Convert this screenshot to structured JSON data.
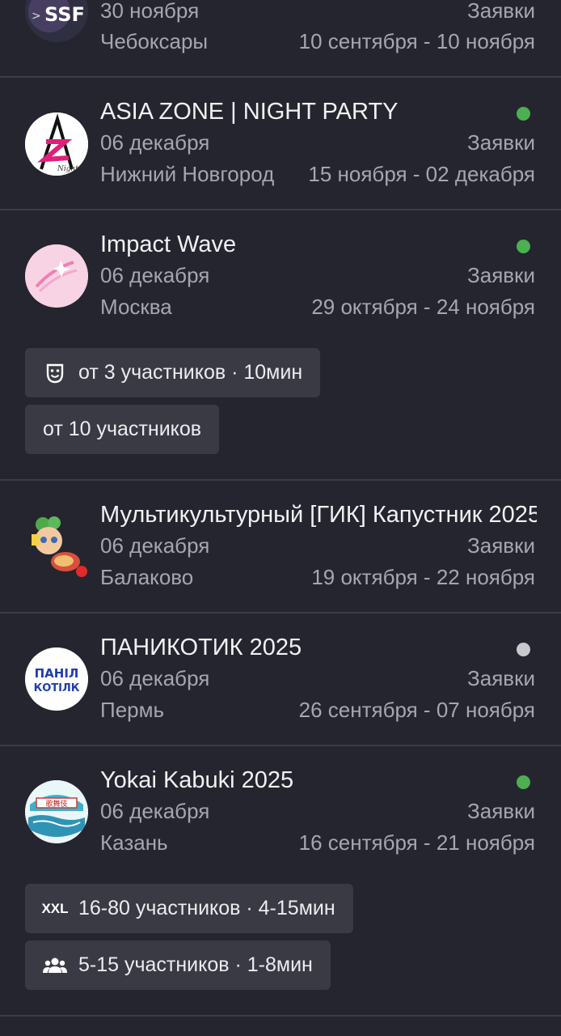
{
  "events": [
    {
      "title": "",
      "date": "30 ноября",
      "status": "Заявки",
      "city": "Чебоксары",
      "period": "10 сентября - 10 ноября",
      "avatar_text": "SSF"
    },
    {
      "title": "ASIA ZONE | NIGHT PARTY",
      "date": "06 декабря",
      "status": "Заявки",
      "city": "Нижний Новгород",
      "period": "15 ноября - 02 декабря",
      "indicator": "green"
    },
    {
      "title": "Impact Wave",
      "date": "06 декабря",
      "status": "Заявки",
      "city": "Москва",
      "period": "29 октября - 24 ноября",
      "indicator": "green",
      "chips": [
        {
          "icon": "theater-mask-icon",
          "label": "от 3 участников · 10мин"
        },
        {
          "icon": "",
          "label": "от 10 участников"
        }
      ]
    },
    {
      "title": "Мультикультурный [ГИК] Капустник 2025",
      "date": "06 декабря",
      "status": "Заявки",
      "city": "Балаково",
      "period": "19 октября - 22 ноября"
    },
    {
      "title": "ПАНИКОТИК 2025",
      "date": "06 декабря",
      "status": "Заявки",
      "city": "Пермь",
      "period": "26 сентября - 07 ноября",
      "indicator": "gray",
      "avatar_text_top": "ПАНІЛ",
      "avatar_text_bottom": "КОТІЛК"
    },
    {
      "title": "Yokai Kabuki 2025",
      "date": "06 декабря",
      "status": "Заявки",
      "city": "Казань",
      "period": "16 сентября - 21 ноября",
      "indicator": "green",
      "chips": [
        {
          "icon": "xxl-icon",
          "icon_text": "XXL",
          "label": "16-80 участников · 4-15мин"
        },
        {
          "icon": "group-icon",
          "label": "5-15 участников · 1-8мин"
        }
      ]
    }
  ],
  "colors": {
    "background": "#25252f",
    "chip": "#3a3a45",
    "indicator_green": "#4caf50",
    "indicator_gray": "#c8c8cc"
  }
}
